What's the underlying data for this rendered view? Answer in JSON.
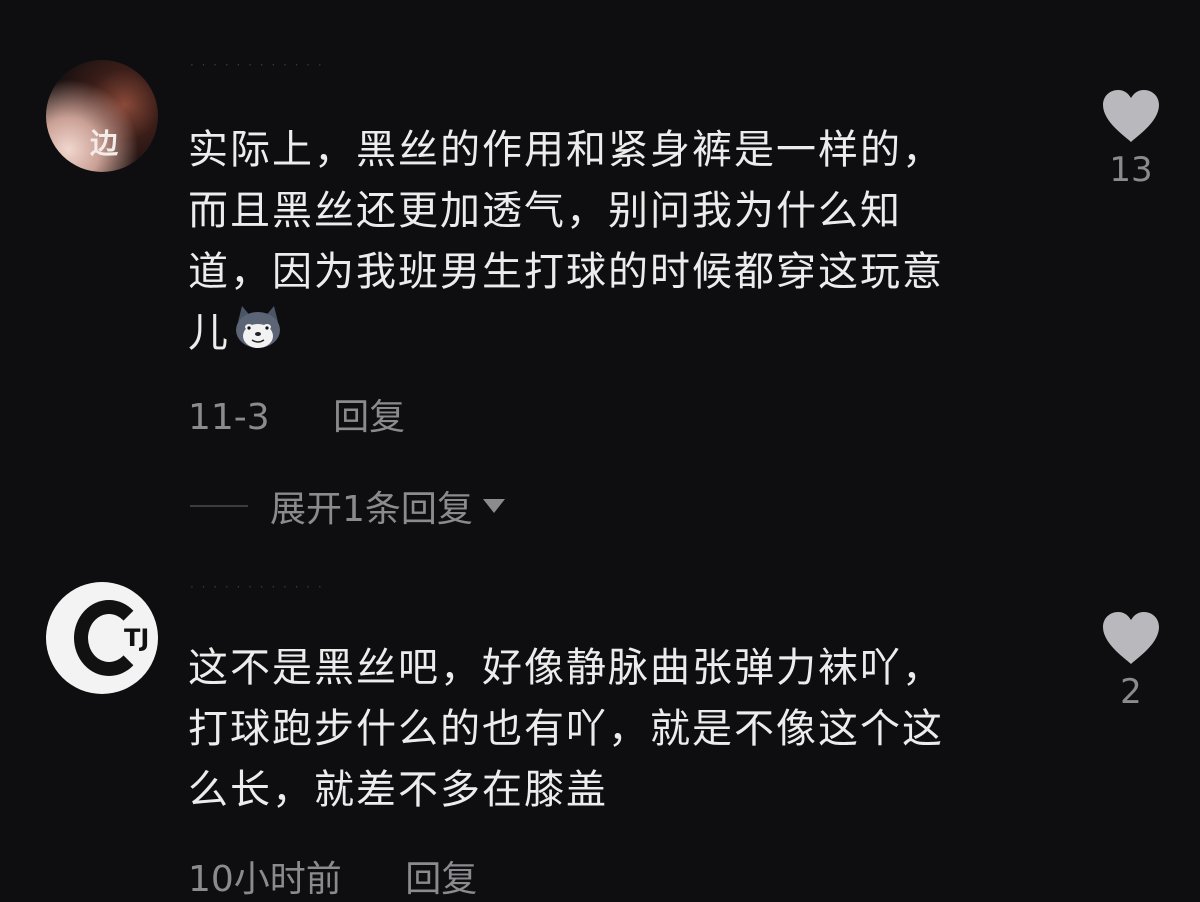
{
  "comments": [
    {
      "username": "· · · · · · · · · · · ·",
      "avatar_text": "边",
      "text": "实际上，黑丝的作用和紧身裤是一样的，\n而且黑丝还更加透气，别问我为什么知\n道，因为我班男生打球的时候都穿这玩意\n儿",
      "emoji": "husky-dog-emoji",
      "date": "11-3",
      "reply_label": "回复",
      "likes": "13",
      "expand_label": "展开1条回复"
    },
    {
      "username": "· · · · · · · · · · · ·",
      "avatar_text": "TJ",
      "text": "这不是黑丝吧，好像静脉曲张弹力袜吖，\n打球跑步什么的也有吖，就是不像这个这\n么长，就差不多在膝盖",
      "date": "10小时前",
      "reply_label": "回复",
      "likes": "2"
    }
  ],
  "colors": {
    "background": "#0e0e10",
    "text": "#ececec",
    "secondary": "#8b8b8f",
    "heart": "#b9b9bd"
  }
}
